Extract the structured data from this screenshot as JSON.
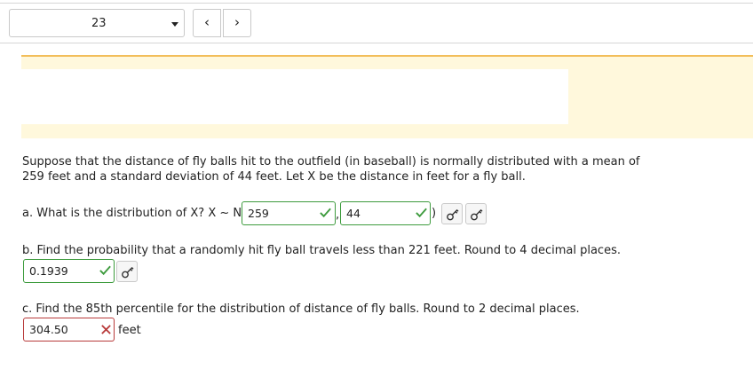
{
  "navigation": {
    "question_number": "23",
    "prev_label": "‹",
    "next_label": "›"
  },
  "question": {
    "intro_line1": "Suppose that the distance of fly balls hit to the outfield (in baseball) is normally distributed with a mean of",
    "intro_line2": "259 feet and a standard deviation of 44 feet. Let X be the distance in feet for a fly ball.",
    "part_a": {
      "prompt": "a. What is the distribution of X? X ~ N(",
      "mean_value": "259",
      "separator": ",",
      "sd_value": "44",
      "close": ")"
    },
    "part_b": {
      "prompt": "b. Find the probability that a randomly hit fly ball travels less than 221 feet. Round to 4 decimal places.",
      "answer": "0.1939"
    },
    "part_c": {
      "prompt": "c. Find the 85th percentile for the distribution of distance of fly balls. Round to 2 decimal places.",
      "answer": "304.50",
      "unit": "feet"
    }
  },
  "colors": {
    "correct": "#3d9b3d",
    "incorrect": "#b83a3a",
    "band": "#fff8dc",
    "band_border": "#f2be5a"
  },
  "icons": {
    "correct": "check-icon",
    "incorrect": "x-icon",
    "key": "key-icon"
  }
}
